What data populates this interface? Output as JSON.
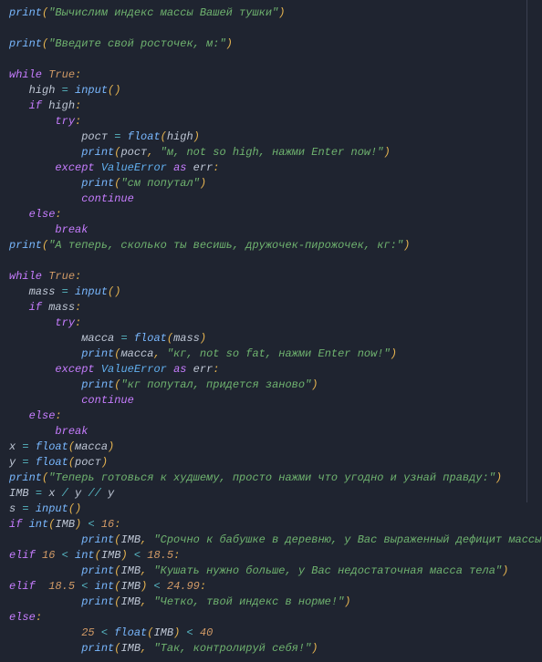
{
  "code": {
    "s1": "\"Вычислим индекс массы Вашей тушки\"",
    "s2": "\"Введите свой росточек, м:\"",
    "kwWhile": "while",
    "kwTrue": "True",
    "idHigh": "high",
    "fnInput": "input",
    "kwIf": "if",
    "kwTry": "try",
    "idRost": "рост",
    "fnFloat": "float",
    "fnPrint": "print",
    "s3": "\"м, not so high, нажми Enter now!\"",
    "kwExcept": "except",
    "clsValueError": "ValueError",
    "kwAs": "as",
    "idErr": "err",
    "s4": "\"см попутал\"",
    "kwContinue": "continue",
    "kwElse": "else",
    "kwBreak": "break",
    "s5": "\"А теперь, сколько ты весишь, дружочек-пирожочек, кг:\"",
    "idMass": "mass",
    "idMassa": "масса",
    "s6": "\"кг, not so fat, нажми Enter now!\"",
    "s7": "\"кг попутал, придется заново\"",
    "idX": "x",
    "idY": "y",
    "s8": "\"Теперь готовься к худшему, просто нажми что угодно и узнай правду:\"",
    "idIMB": "IMB",
    "idS": "s",
    "fnInt": "int",
    "n16": "16",
    "s9": "\"Срочно к бабушке в деревню, у Вас выраженный дефицит массы тела!!!\"",
    "kwElif": "elif",
    "n185": "18.5",
    "s10": "\"Кушать нужно больше, у Вас недостаточная масса тела\"",
    "n2499": "24.99",
    "s11": "\"Четко, твой индекс в норме!\"",
    "n25": "25",
    "n40": "40",
    "s12": "\"Так, контролируй себя!\""
  }
}
